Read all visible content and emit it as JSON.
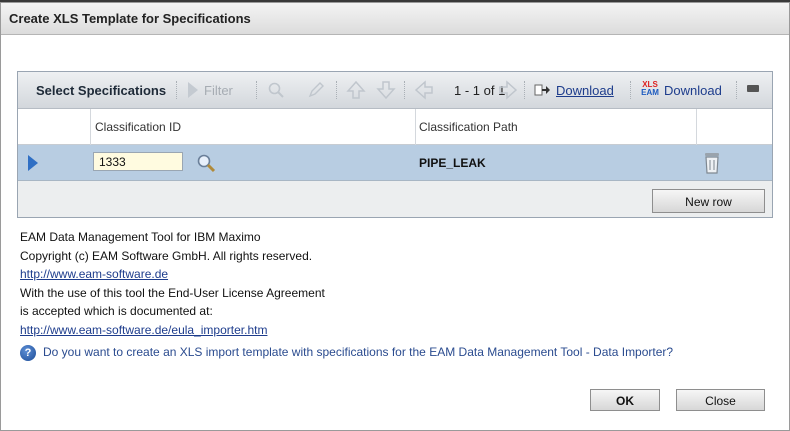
{
  "dialog": {
    "title": "Create XLS Template for Specifications"
  },
  "toolbar": {
    "title": "Select Specifications",
    "filter_label": "Filter",
    "page_info": "1 - 1 of 1",
    "download_label": "Download",
    "xls_download_label": "Download",
    "xls_logo_top": "XLS",
    "xls_logo_bottom": "EAM"
  },
  "table": {
    "columns": [
      "Classification ID",
      "Classification Path"
    ],
    "rows": [
      {
        "classification_id": "1333",
        "classification_path": "PIPE_LEAK"
      }
    ],
    "new_row_label": "New row"
  },
  "info": {
    "line1": "EAM Data Management Tool for IBM Maximo",
    "line2": "Copyright (c) EAM Software GmbH. All rights reserved.",
    "link1": "http://www.eam-software.de",
    "line3": "With the use of this tool the End-User License Agreement",
    "line4": "is accepted which is documented at:",
    "link2": "http://www.eam-software.de/eula_importer.htm"
  },
  "question": "Do you want to create an XLS import template with specifications for the EAM Data Management Tool - Data Importer?",
  "buttons": {
    "ok": "OK",
    "close": "Close"
  },
  "icons": [
    "filter-icon",
    "find-icon",
    "edit-icon",
    "up-icon",
    "down-icon",
    "prev-page-icon",
    "next-page-icon",
    "download-icon",
    "xls-eam-icon",
    "minimize-icon",
    "row-select-icon",
    "lookup-icon",
    "delete-icon",
    "help-icon"
  ]
}
